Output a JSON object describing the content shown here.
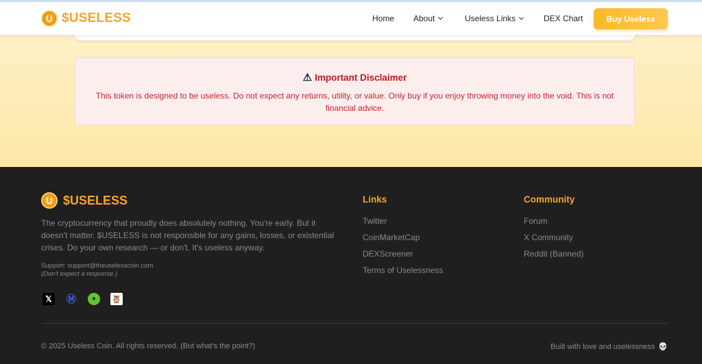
{
  "header": {
    "logo_letter": "U",
    "brand": "$USELESS",
    "nav": {
      "home": "Home",
      "about": "About",
      "useless_links": "Useless Links",
      "dex_chart": "DEX Chart"
    },
    "buy_button": "Buy Useless"
  },
  "disclaimer": {
    "icon": "warning-icon",
    "title": "Important Disclaimer",
    "text": "This token is designed to be useless. Do not expect any returns, utility, or value. Only buy if you enjoy throwing money into the void. This is not financial advice."
  },
  "footer": {
    "brand": "$USELESS",
    "description": "The cryptocurrency that proudly does absolutely nothing. You're early. But it doesn't matter. $USELESS is not responsible for any gains, losses, or existential crises. Do your own research — or don't. It's useless anyway.",
    "support": "Support: support@theuselesscoin.com",
    "support_note": "(Don't expect a response.)",
    "socials": [
      "x-icon",
      "coinmarketcap-icon",
      "dexscreener-icon",
      "bird-icon"
    ],
    "links_title": "Links",
    "links": [
      "Twitter",
      "CoinMarketCap",
      "DEXScreener",
      "Terms of Uselessness"
    ],
    "community_title": "Community",
    "community": [
      "Forum",
      "X Community",
      "Reddit (Banned)"
    ],
    "copyright": "© 2025 Useless Coin. All rights reserved. (But what's the point?)",
    "built": "Built with love and uselessness"
  },
  "colors": {
    "accent": "#f5a524",
    "footer_bg": "#1f1f1f",
    "disclaimer_bg": "#fdeeee",
    "disclaimer_text": "#c0262d"
  }
}
